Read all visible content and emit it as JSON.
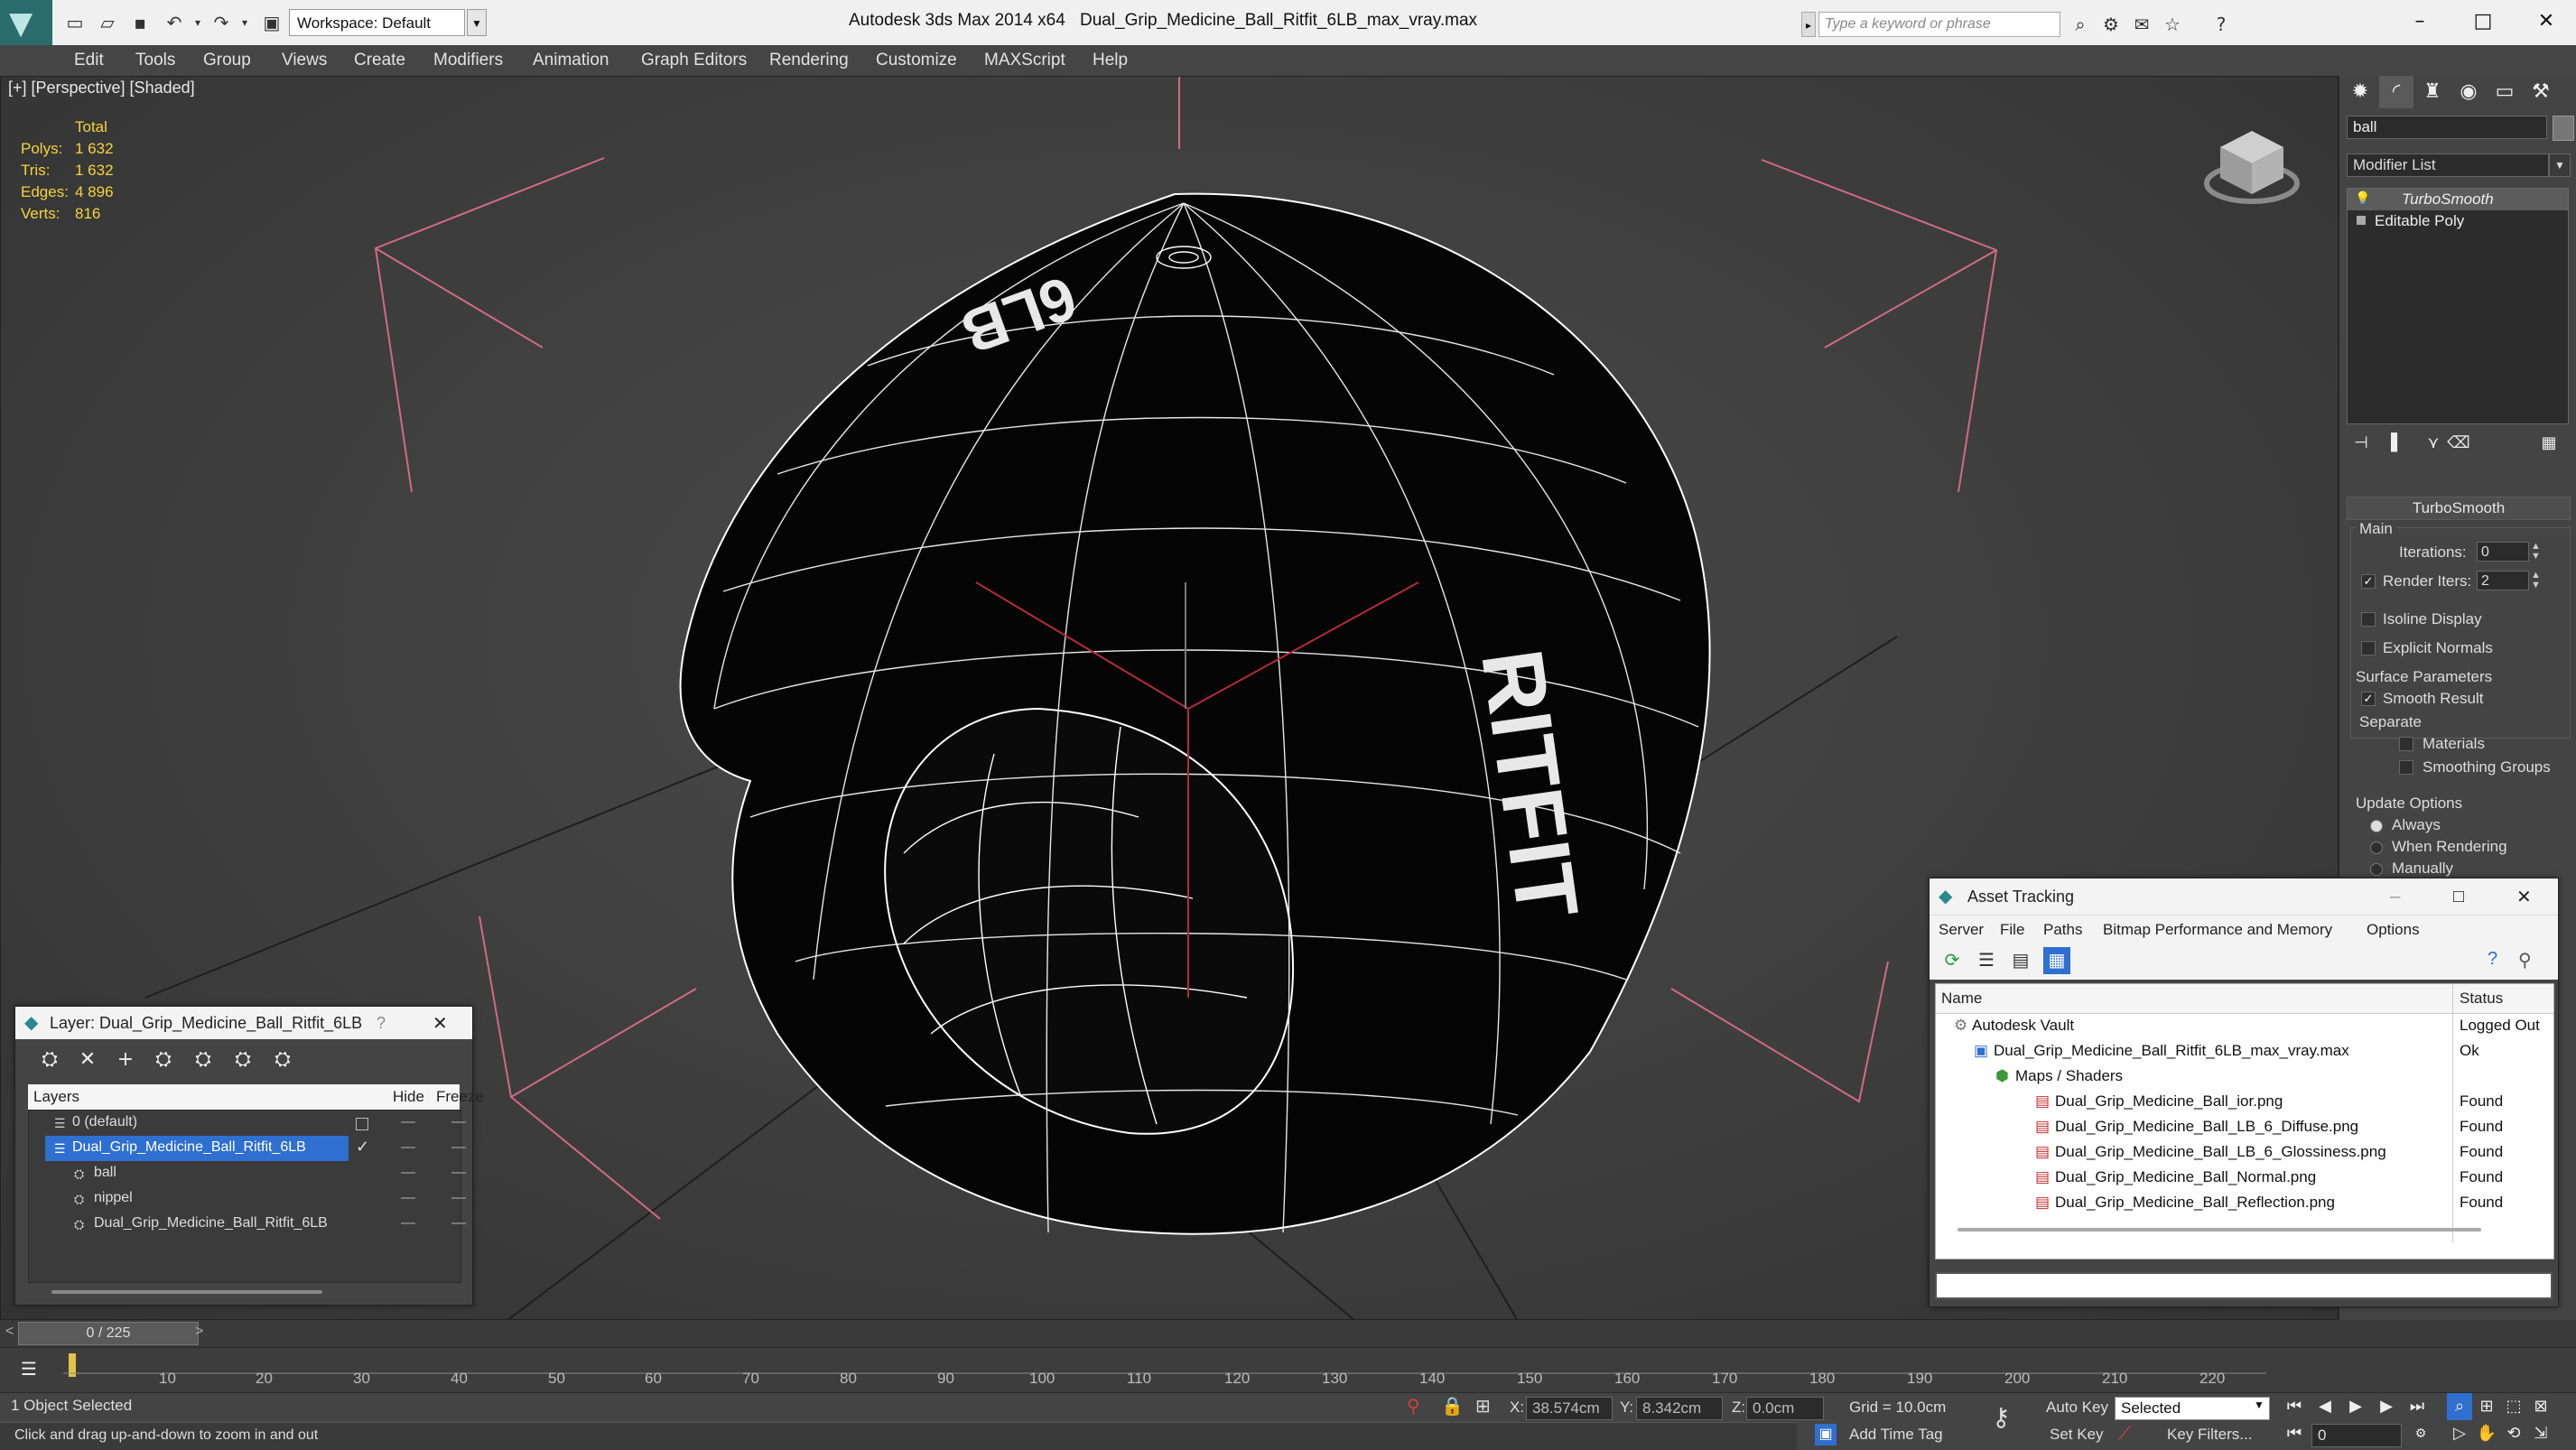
{
  "titlebar": {
    "workspace": "Workspace: Default",
    "app_title": "Autodesk 3ds Max  2014 x64",
    "file_title": "Dual_Grip_Medicine_Ball_Ritfit_6LB_max_vray.max",
    "search_placeholder": "Type a keyword or phrase"
  },
  "menu": [
    "Edit",
    "Tools",
    "Group",
    "Views",
    "Create",
    "Modifiers",
    "Animation",
    "Graph Editors",
    "Rendering",
    "Customize",
    "MAXScript",
    "Help"
  ],
  "viewport": {
    "label": "[+] [Perspective] [Shaded]",
    "stats_header": "Total",
    "stats": [
      {
        "label": "Polys:",
        "value": "1 632"
      },
      {
        "label": "Tris:",
        "value": "1 632"
      },
      {
        "label": "Edges:",
        "value": "4 896"
      },
      {
        "label": "Verts:",
        "value": "816"
      }
    ],
    "ball_text_top": "6LB",
    "ball_text_side": "RITFIT"
  },
  "command_panel": {
    "object_name": "ball",
    "modifier_list": "Modifier List",
    "stack": [
      "TurboSmooth",
      "Editable Poly"
    ],
    "rollout_title": "TurboSmooth",
    "main_group": "Main",
    "iterations_label": "Iterations:",
    "iterations_value": "0",
    "render_iters_label": "Render Iters:",
    "render_iters_value": "2",
    "isoline": "Isoline Display",
    "explicit": "Explicit Normals",
    "surface_group": "Surface Parameters",
    "smooth_result": "Smooth Result",
    "separate": "Separate",
    "materials": "Materials",
    "smoothing_groups": "Smoothing Groups",
    "update_group": "Update Options",
    "always": "Always",
    "when_rendering": "When Rendering",
    "manually": "Manually"
  },
  "layer_window": {
    "title": "Layer: Dual_Grip_Medicine_Ball_Ritfit_6LB",
    "help": "?",
    "columns": {
      "layers": "Layers",
      "hide": "Hide",
      "freeze": "Freeze"
    },
    "rows": [
      {
        "name": "0 (default)"
      },
      {
        "name": "Dual_Grip_Medicine_Ball_Ritfit_6LB"
      },
      {
        "name": "ball"
      },
      {
        "name": "nippel"
      },
      {
        "name": "Dual_Grip_Medicine_Ball_Ritfit_6LB"
      }
    ]
  },
  "asset_window": {
    "title": "Asset Tracking",
    "menu": [
      "Server",
      "File",
      "Paths",
      "Bitmap Performance and Memory",
      "Options"
    ],
    "columns": {
      "name": "Name",
      "status": "Status"
    },
    "rows": [
      {
        "name": "Autodesk Vault",
        "status": "Logged Out"
      },
      {
        "name": "Dual_Grip_Medicine_Ball_Ritfit_6LB_max_vray.max",
        "status": "Ok"
      },
      {
        "name": "Maps / Shaders",
        "status": ""
      },
      {
        "name": "Dual_Grip_Medicine_Ball_ior.png",
        "status": "Found"
      },
      {
        "name": "Dual_Grip_Medicine_Ball_LB_6_Diffuse.png",
        "status": "Found"
      },
      {
        "name": "Dual_Grip_Medicine_Ball_LB_6_Glossiness.png",
        "status": "Found"
      },
      {
        "name": "Dual_Grip_Medicine_Ball_Normal.png",
        "status": "Found"
      },
      {
        "name": "Dual_Grip_Medicine_Ball_Reflection.png",
        "status": "Found"
      }
    ]
  },
  "timeline": {
    "frame": "0 / 225",
    "ticks": [
      "10",
      "20",
      "30",
      "40",
      "50",
      "60",
      "70",
      "80",
      "90",
      "100",
      "110",
      "120",
      "130",
      "140",
      "150",
      "160",
      "170",
      "180",
      "190",
      "200",
      "210",
      "220"
    ]
  },
  "status": {
    "selection": "1 Object Selected",
    "prompt": "Click and drag up-and-down to zoom in and out",
    "x_label": "X:",
    "x_value": "38.574cm",
    "y_label": "Y:",
    "y_value": "8.342cm",
    "z_label": "Z:",
    "z_value": "0.0cm",
    "grid": "Grid = 10.0cm",
    "add_time_tag": "Add Time Tag",
    "auto_key": "Auto Key",
    "set_key": "Set Key",
    "selected": "Selected",
    "key_filters": "Key Filters...",
    "frame_value": "0"
  }
}
